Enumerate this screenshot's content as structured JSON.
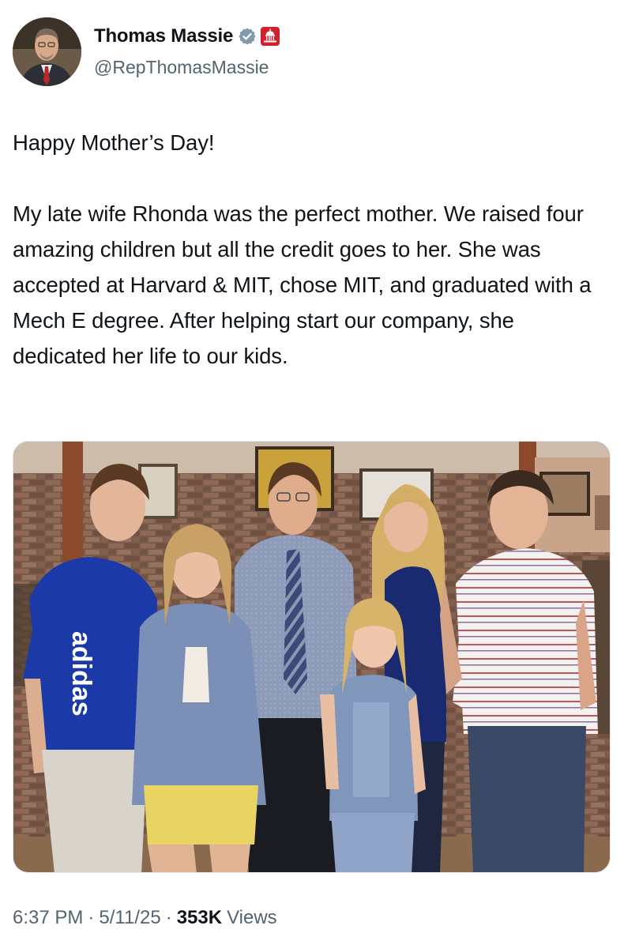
{
  "author": {
    "display_name": "Thomas Massie",
    "handle": "@RepThomasMassie",
    "verified_icon": "verified-badge-icon",
    "affiliation_icon": "us-capitol-badge-icon",
    "badge_color": "#829aab",
    "affiliation_color": "#d0212c"
  },
  "tweet": {
    "text": "Happy Mother’s Day!\n\nMy late wife Rhonda was the perfect mother. We raised four amazing children but all the credit goes to her. She was accepted at Harvard & MIT, chose MIT, and graduated with a Mech E degree. After helping start our company, she dedicated her life to our kids."
  },
  "meta": {
    "time": "6:37 PM",
    "date": "5/11/25",
    "separator": "·",
    "views_count": "353K",
    "views_label": "Views"
  },
  "colors": {
    "text_primary": "#0f1419",
    "text_secondary": "#536471",
    "background": "#ffffff"
  }
}
